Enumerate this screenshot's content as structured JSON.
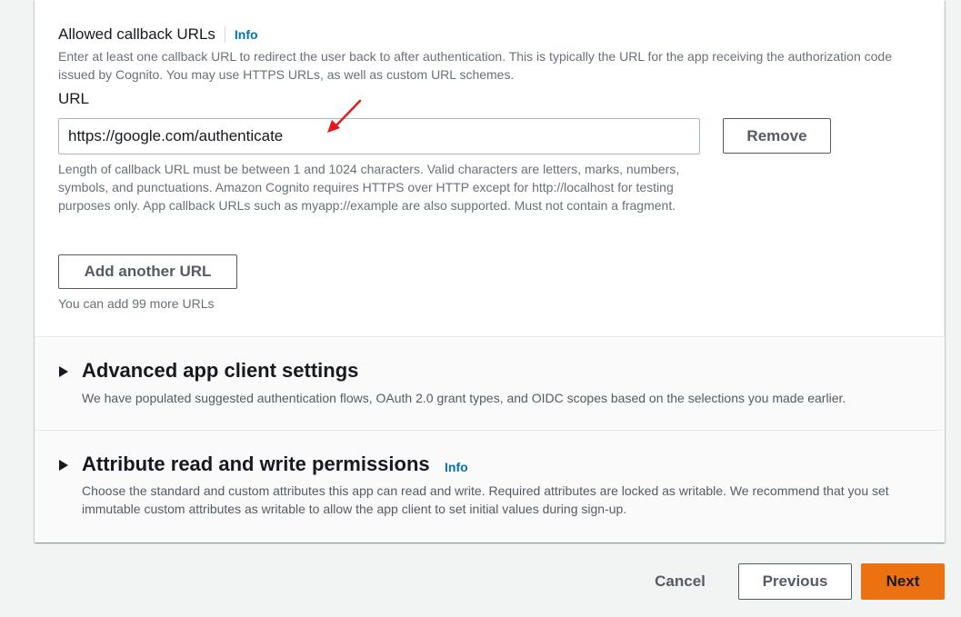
{
  "callback": {
    "label": "Allowed callback URLs",
    "info_label": "Info",
    "description": "Enter at least one callback URL to redirect the user back to after authentication. This is typically the URL for the app receiving the authorization code issued by Cognito. You may use HTTPS URLs, as well as custom URL schemes.",
    "url_label": "URL",
    "url_value": "https://google.com/authenticate",
    "remove_label": "Remove",
    "hint": "Length of callback URL must be between 1 and 1024 characters. Valid characters are letters, marks, numbers, symbols, and punctuations. Amazon Cognito requires HTTPS over HTTP except for http://localhost for testing purposes only. App callback URLs such as myapp://example are also supported. Must not contain a fragment.",
    "add_label": "Add another URL",
    "remaining": "You can add 99 more URLs"
  },
  "advanced": {
    "title": "Advanced app client settings",
    "description": "We have populated suggested authentication flows, OAuth 2.0 grant types, and OIDC scopes based on the selections you made earlier."
  },
  "attributes": {
    "title": "Attribute read and write permissions",
    "info_label": "Info",
    "description": "Choose the standard and custom attributes this app can read and write. Required attributes are locked as writable. We recommend that you set immutable custom attributes as writable to allow the app client to set initial values during sign-up."
  },
  "footer": {
    "cancel_label": "Cancel",
    "previous_label": "Previous",
    "next_label": "Next"
  },
  "colors": {
    "primary": "#ec7211",
    "link": "#0073bb",
    "annotation_arrow": "#e3191c"
  }
}
